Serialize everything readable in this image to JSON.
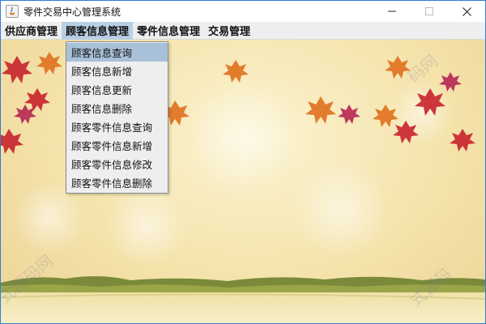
{
  "window": {
    "title": "零件交易中心管理系统"
  },
  "menubar": {
    "menus": [
      {
        "label": "供应商管理"
      },
      {
        "label": "顾客信息管理"
      },
      {
        "label": "零件信息管理"
      },
      {
        "label": "交易管理"
      }
    ]
  },
  "dropdown": {
    "items": [
      {
        "label": "顾客信息查询"
      },
      {
        "label": "顾客信息新增"
      },
      {
        "label": "顾客信息更新"
      },
      {
        "label": "顾客信息删除"
      },
      {
        "label": "顾客零件信息查询"
      },
      {
        "label": "顾客零件信息新增"
      },
      {
        "label": "顾客零件信息修改"
      },
      {
        "label": "顾客零件信息删除"
      }
    ]
  },
  "watermarks": {
    "top_right": "码网",
    "bottom_left": "式源码网",
    "bottom_right": "式源码"
  },
  "colors": {
    "menu_highlight": "#b8cfe5",
    "item_highlight": "#a8c0d8",
    "window_border": "#2f7cd6"
  }
}
